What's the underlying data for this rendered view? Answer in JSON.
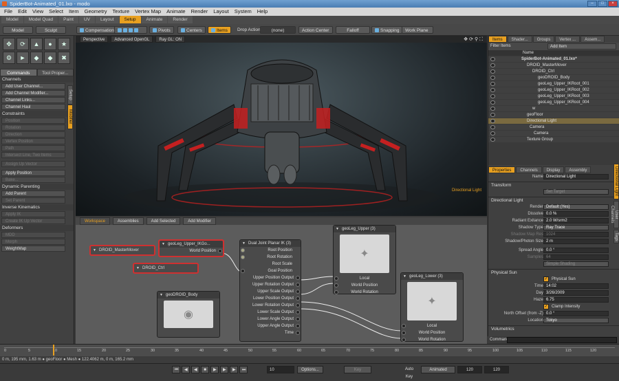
{
  "window": {
    "title": "SpiderBot-Animated_01.lxo - modo"
  },
  "menu": [
    "File",
    "Edit",
    "View",
    "Select",
    "Item",
    "Geometry",
    "Texture",
    "Vertex Map",
    "Animate",
    "Render",
    "Layout",
    "System",
    "Help"
  ],
  "layout_tabs": [
    "Model",
    "Model Quad",
    "Paint",
    "UV",
    "Layout",
    "Setup",
    "Animate",
    "Render"
  ],
  "toolbar": {
    "model": "Model",
    "sculpt": "Sculpt",
    "compensation": "Compensation",
    "pivots": "Pivots",
    "centers": "Centers",
    "items": "Items",
    "drop_action_label": "Drop Action",
    "drop_action_value": "(none)",
    "action_center": "Action Center",
    "falloff": "Falloff",
    "snapping": "Snapping",
    "work_plane": "Work Plane"
  },
  "left": {
    "tabs": [
      "Commands",
      "Tool Proper..."
    ],
    "channels_section": "Channels",
    "channel_buttons": [
      "Add User Channel...",
      "Add Channel Modifier...",
      "Channel Links...",
      "Channel Haul"
    ],
    "constraints_section": "Constraints",
    "constraint_buttons": [
      "Position",
      "Rotation",
      "Direction",
      "Vertex Position",
      "Path",
      "Intersect Line, Two Items"
    ],
    "assign_up": "Assign Up Vector",
    "apply_position": "Apply Position",
    "bake": "Bake...",
    "dynamic_parenting": "Dynamic Parenting",
    "add_parent": "Add Parent",
    "set_parent": "Set Parent",
    "inverse_kinematics": "Inverse Kinematics",
    "ik_buttons": [
      "Apply IK",
      "Create IK Up Vector"
    ],
    "deformers": "Deformers",
    "deformer_buttons": [
      "MDD",
      "Morph",
      "WeightMap"
    ],
    "side_tabs": [
      "Setup",
      "Modifier"
    ]
  },
  "viewport": {
    "view": "Perspective",
    "shading": "Advanced OpenGL",
    "raygl": "Ray GL: ON",
    "light_label": "Directional Light"
  },
  "schematic": {
    "tabs": [
      "Workspace",
      "Assemblies",
      "Add Selected",
      "Add Modifier"
    ],
    "nodes": {
      "mover": "DROID_MasterMover",
      "ikgoal": "geoLeg_Upper_IKGo...",
      "ikgoal_port": "World Position",
      "ctrl": "DROID_Ctrl",
      "body": "geoDROID_Body",
      "ik": "Dual Joint Planar IK (3)",
      "ik_ports": [
        "Root Position",
        "Root Rotation",
        "Root Scale",
        "Goal Position",
        "Upper Position Output",
        "Upper Rotation Output",
        "Upper Scale Output",
        "Lower Position Output",
        "Lower Rotation Output",
        "Lower Scale Output",
        "Lower Angle Output",
        "Upper Angle Output",
        "Time"
      ],
      "upper": "geoLeg_Upper (3)",
      "upper_ports": [
        "Local",
        "World Position",
        "World Rotation"
      ],
      "lower": "geoLeg_Lower (3)",
      "lower_ports": [
        "Local",
        "World Position",
        "World Rotation"
      ]
    }
  },
  "items_panel": {
    "tabs": [
      "Items",
      "Shader...",
      "Groups",
      "Vertex ...",
      "Assem..."
    ],
    "filter": "Filter Items",
    "add_item": "Add Item",
    "name_col": "Name",
    "tree": [
      "SpiderBot-Animated_01.lxo*",
      "DROID_MasterMover",
      "DROID_Ctrl",
      "geoDROID_Body",
      "geoLeg_Upper_IKRoot_001",
      "geoLeg_Upper_IKRoot_002",
      "geoLeg_Upper_IKRoot_003",
      "geoLeg_Upper_IKRoot_004",
      "w",
      "geoFloor",
      "Directional Light",
      "Camera",
      "Camera",
      "Texture Group"
    ]
  },
  "properties": {
    "tabs": [
      "Properties",
      "Channels",
      "Display",
      "Assembly"
    ],
    "name_label": "Name",
    "name_value": "Directional Light",
    "transform": "Transform",
    "set_target": "Set Target",
    "light_section": "Directional Light",
    "rows": [
      [
        "Render",
        "Default (Yes)"
      ],
      [
        "Dissolve",
        "0.0 %"
      ],
      [
        "Radiant Exitance",
        "2.0 W/srm2"
      ],
      [
        "Shadow Type",
        "Ray Trace"
      ],
      [
        "Shadow Map Res",
        "1024"
      ],
      [
        "Shadow/Photon Size",
        "2 m"
      ],
      [
        "Spread Angle",
        "0.0 °"
      ],
      [
        "Samples",
        "64"
      ]
    ],
    "simple_shading": "Simple Shading",
    "physical_sun": "Physical Sun",
    "physical_sun_chk": "Physical Sun",
    "sun_rows": [
      [
        "Time",
        "14:02"
      ],
      [
        "Day",
        "3/26/2009"
      ],
      [
        "Haze",
        "6.75"
      ]
    ],
    "clamp": "Clamp Intensity",
    "north_label": "North Offset (from -Z)",
    "north": "0.0 °",
    "location_label": "Location",
    "location": "Tokyo",
    "volumetrics": "Volumetrics",
    "side_tabs": [
      "Directional Light",
      "User Channels",
      "Tags"
    ]
  },
  "command_label": "Command",
  "timeline": {
    "ticks": [
      "0",
      "5",
      "10",
      "15",
      "20",
      "25",
      "30",
      "35",
      "40",
      "45",
      "50",
      "55",
      "60",
      "65",
      "70",
      "75",
      "80",
      "85",
      "90",
      "95",
      "100",
      "105",
      "110",
      "115",
      "120"
    ]
  },
  "status": "0 m, 195 mm, 1.63 m ● geoFloor ● Mesh ● 122.4062 m, 0 m, 165.2 mm",
  "bottom": {
    "frame": "10",
    "options": "Options...",
    "key": "Key",
    "autokey": "Auto Key",
    "animated": "Animated",
    "start": "120",
    "end": "120"
  }
}
